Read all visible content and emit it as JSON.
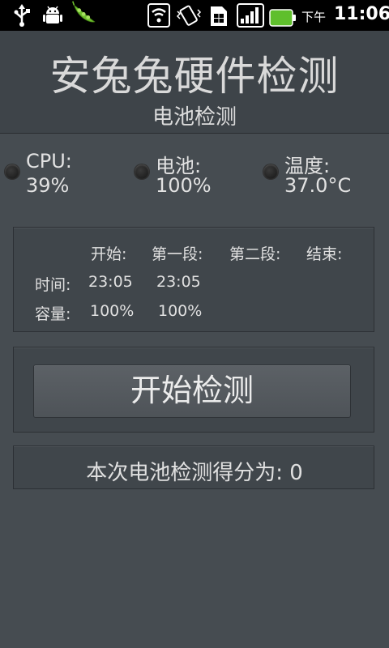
{
  "status_bar": {
    "icons": [
      "usb-icon",
      "android-debug-icon",
      "peapod-app-icon",
      "wifi-icon",
      "vibrate-icon",
      "sim-card-icon",
      "signal-strength-icon",
      "battery-icon"
    ],
    "time_period": "下午",
    "time": "11:06",
    "battery_color": "#5fbf2c"
  },
  "header": {
    "app_title": "安兔兔硬件检测",
    "sub_title": "电池检测"
  },
  "indicators": [
    {
      "label": "CPU:",
      "value": "39%"
    },
    {
      "label": "电池:",
      "value": "100%"
    },
    {
      "label": "温度:",
      "value": "37.0°C"
    }
  ],
  "table": {
    "headers": [
      "开始:",
      "第一段:",
      "第二段:",
      "结束:"
    ],
    "rows": [
      {
        "label": "时间:",
        "values": [
          "23:05",
          "23:05"
        ]
      },
      {
        "label": "容量:",
        "values": [
          "100%",
          "100%"
        ]
      }
    ]
  },
  "actions": {
    "start_label": "开始检测"
  },
  "result": {
    "score_text": "本次电池检测得分为: 0"
  }
}
